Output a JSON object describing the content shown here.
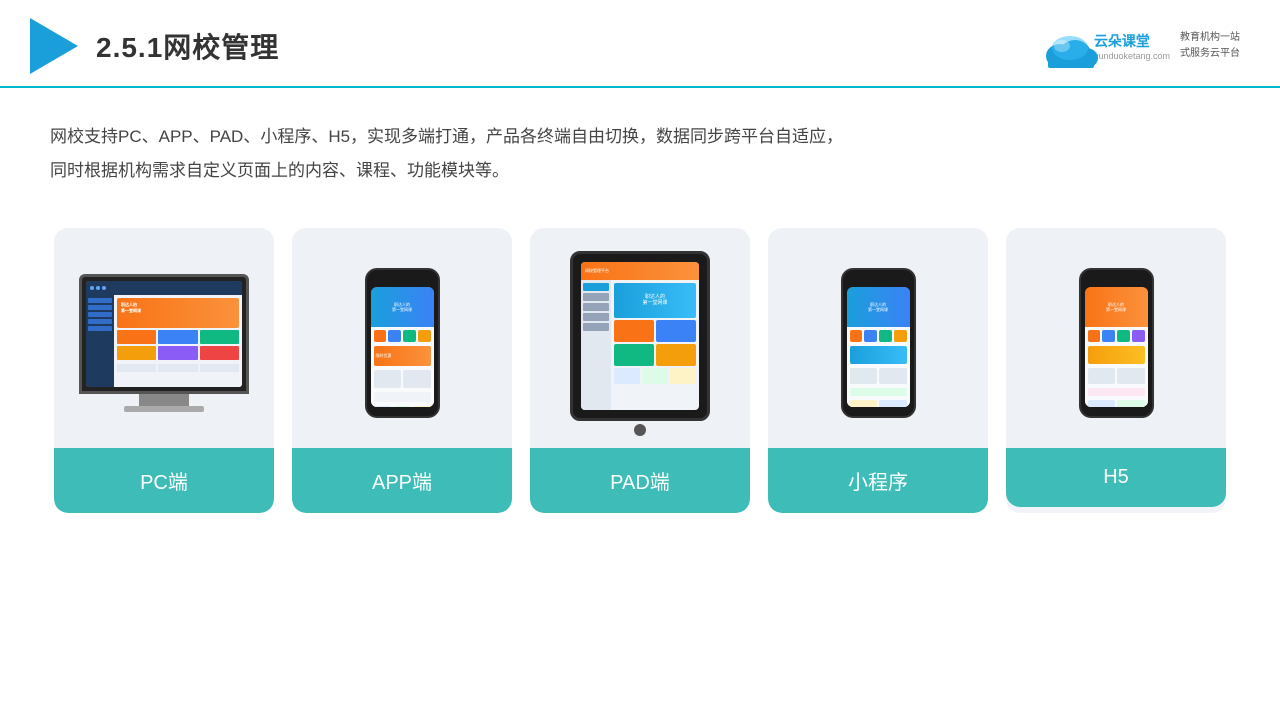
{
  "header": {
    "title": "2.5.1网校管理",
    "brand": {
      "name": "云朵课堂",
      "url": "yunduoketang.com",
      "tagline_line1": "教育机构一站",
      "tagline_line2": "式服务云平台"
    }
  },
  "description": {
    "text": "网校支持PC、APP、PAD、小程序、H5，实现多端打通，产品各终端自由切换，数据同步跨平台自适应，同时根据机构需求自定义页面上的内容、课程、功能模块等。"
  },
  "cards": [
    {
      "id": "pc",
      "label": "PC端"
    },
    {
      "id": "app",
      "label": "APP端"
    },
    {
      "id": "pad",
      "label": "PAD端"
    },
    {
      "id": "miniprogram",
      "label": "小程序"
    },
    {
      "id": "h5",
      "label": "H5"
    }
  ],
  "colors": {
    "accent": "#3dbcb8",
    "blue": "#1a9fdb",
    "orange": "#f97316",
    "border": "#00b8c8"
  }
}
